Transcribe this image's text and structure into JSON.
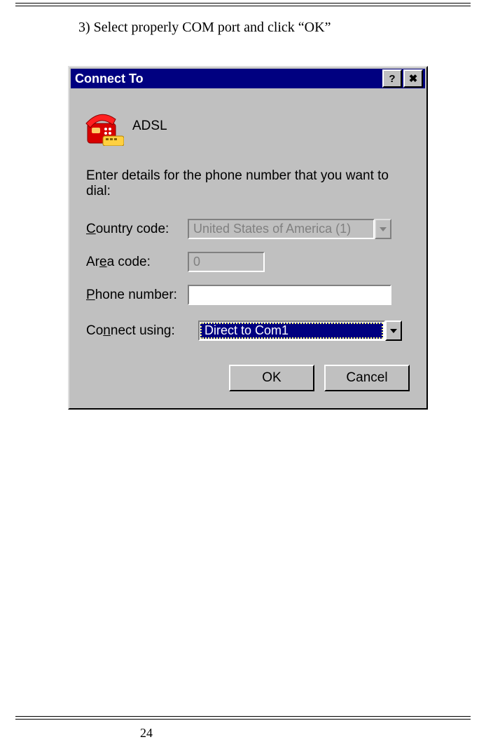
{
  "instruction": "3)  Select properly COM port and click “OK”",
  "page_number": "24",
  "dialog": {
    "title": "Connect To",
    "help_btn": "?",
    "close_btn": "✖",
    "connection_name": "ADSL",
    "prompt": "Enter details for the phone number that you want to dial:",
    "fields": {
      "country_label": "Country code:",
      "country_value": "United States of America (1)",
      "area_label": "Area code:",
      "area_value": "0",
      "phone_label": "Phone number:",
      "phone_value": "",
      "connect_label": "Connect using:",
      "connect_value": "Direct to Com1"
    },
    "buttons": {
      "ok": "OK",
      "cancel": "Cancel"
    }
  }
}
